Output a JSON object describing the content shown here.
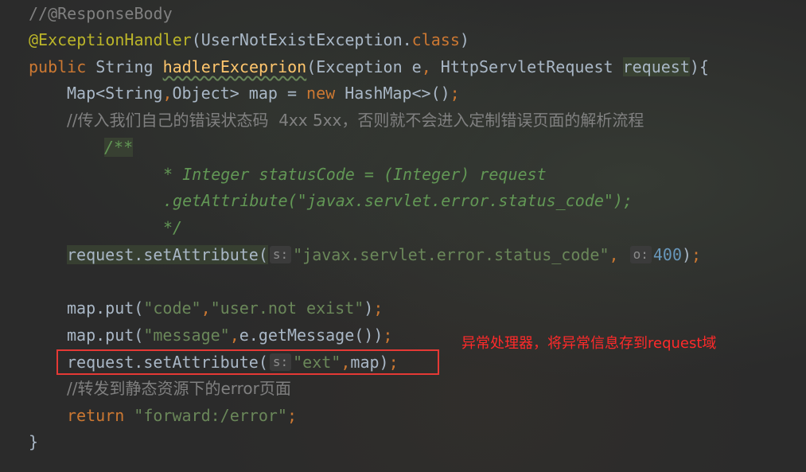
{
  "code": {
    "l1": "//@ResponseBody",
    "l2_annotation": "@ExceptionHandler",
    "l2_rest": "(UserNotExistException.",
    "l2_class": "class",
    "l2_end": ")",
    "l3_public": "public",
    "l3_type": " String ",
    "l3_fn": "hadlerExceprion",
    "l3_rest": "(Exception e",
    "l3_comma": ",",
    "l3_rest2": " HttpServletRequest ",
    "l3_request": "request",
    "l3_end": "){",
    "l4_pre": "Map<String",
    "l4_comma": ",",
    "l4_mid": "Object> map = ",
    "l4_new": "new",
    "l4_post": " HashMap<>()",
    "l4_semi": ";",
    "l5": "//传入我们自己的错误状态码  4xx 5xx，否则就不会进入定制错误页面的解析流程",
    "l6": "/**",
    "l7": "* Integer statusCode = (Integer) request",
    "l8": ".getAttribute(\"javax.servlet.error.status_code\");",
    "l9": "*/",
    "l10_pre": "request.setAttribute(",
    "l10_hint1": "s:",
    "l10_str": "\"javax.servlet.error.status_code\"",
    "l10_comma": ",",
    "l10_hint2": "o:",
    "l10_num": "400",
    "l10_end": ")",
    "l10_semi": ";",
    "l11_pre": "map.put(",
    "l11_s1": "\"code\"",
    "l11_comma": ",",
    "l11_s2": "\"user.not exist\"",
    "l11_end": ")",
    "l11_semi": ";",
    "l12_pre": "map.put(",
    "l12_s1": "\"message\"",
    "l12_comma": ",",
    "l12_rest": "e.getMessage())",
    "l12_semi": ";",
    "l13_pre": "request.setAttribute(",
    "l13_hint": "s:",
    "l13_str": "\"ext\"",
    "l13_comma": ",",
    "l13_rest": "map)",
    "l13_semi": ";",
    "l14": "//转发到静态资源下的error页面",
    "l15_return": "return",
    "l15_str": " \"forward:/error\"",
    "l15_semi": ";",
    "l16": "}"
  },
  "annotation_note": "异常处理器，将异常信息存到request域",
  "colors": {
    "background": "#2b2b2b",
    "keyword": "#cc7832",
    "string": "#6a8759",
    "comment": "#808080",
    "annotation": "#bbb529",
    "number": "#6897bb",
    "function": "#ffc66d",
    "highlight_box": "#e53935",
    "note_text": "#ff2a2a"
  }
}
